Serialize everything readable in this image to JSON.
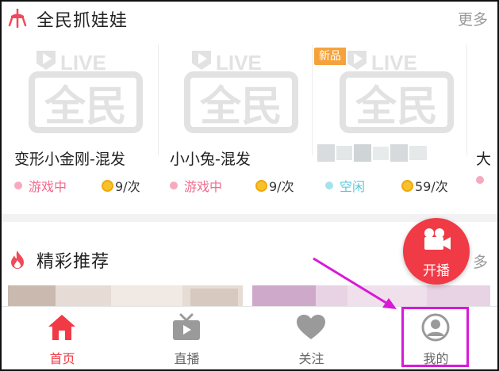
{
  "section_doll": {
    "title": "全民抓娃娃",
    "more": "更多",
    "icon": "claw-machine-icon"
  },
  "cards": [
    {
      "name": "变形小金刚-混发",
      "status": "游戏中",
      "price": "9/次",
      "status_color": "#f06c8e"
    },
    {
      "name": "小小兔-混发",
      "status": "游戏中",
      "price": "9/次",
      "status_color": "#f06c8e"
    },
    {
      "name": "",
      "status": "空闲",
      "price": "59/次",
      "status_color": "#5ac8e0",
      "badge": "新品"
    },
    {
      "name": "大",
      "status": "",
      "price": ""
    }
  ],
  "thumb_logo": {
    "live": "LIVE",
    "brand": "全民"
  },
  "section_recommend": {
    "title": "精彩推荐",
    "icon": "flame-icon"
  },
  "fab": {
    "label": "开播",
    "icon": "video-camera-icon",
    "color": "#f03a46"
  },
  "nav": [
    {
      "label": "首页",
      "icon": "home-icon",
      "active": true
    },
    {
      "label": "直播",
      "icon": "tv-icon",
      "active": false
    },
    {
      "label": "关注",
      "icon": "heart-icon",
      "active": false
    },
    {
      "label": "我的",
      "icon": "user-icon",
      "active": false
    }
  ],
  "colors": {
    "accent": "#f03a46",
    "highlight": "#d81ad8",
    "badge": "#f5a23b"
  }
}
